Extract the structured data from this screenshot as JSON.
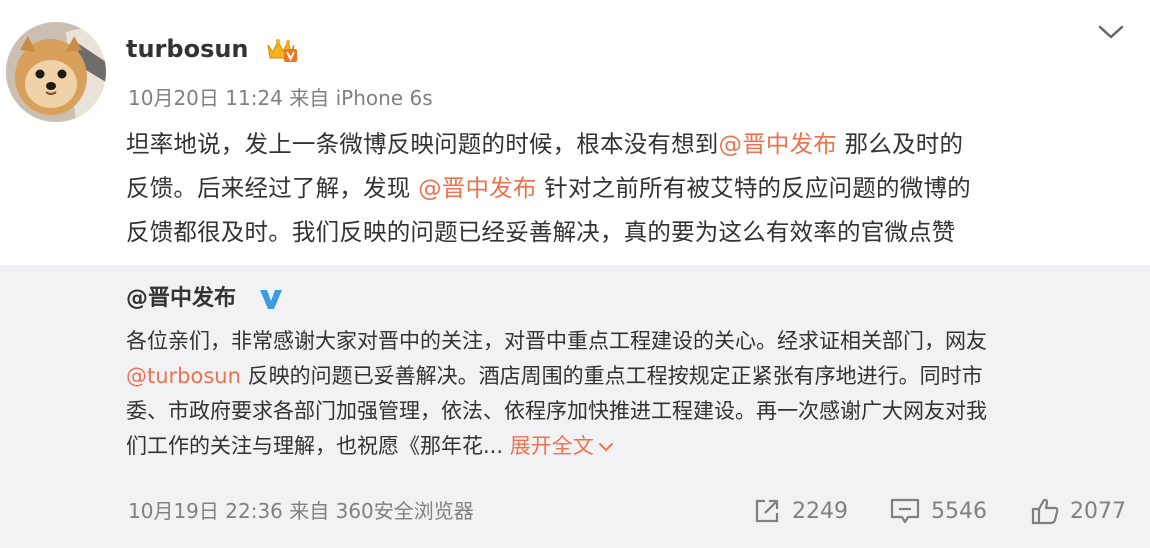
{
  "post": {
    "username": "turbosun",
    "vip_icon": "vip-crown-icon",
    "meta": "10月20日 11:24 来自 iPhone 6s",
    "text": {
      "line1_before": "坦率地说，发上一条微博反映问题的时候，根本没有想到",
      "mention1": "@晋中发布",
      "line1_after": " 那么及时的",
      "line2_before": "反馈。后来经过了解，发现 ",
      "mention2": "@晋中发布",
      "line2_after": " 针对之前所有被艾特的反应问题的微博的",
      "line3": "反馈都很及时。我们反映的问题已经妥善解决，真的要为这么有效率的官微点赞"
    }
  },
  "repost": {
    "author": "@晋中发布",
    "verified_icon": "verified-v-icon",
    "line1": "各位亲们，非常感谢大家对晋中的关注，对晋中重点工程建设的关心。经求证相关部门，网友",
    "mention": "@turbosun",
    "line2_after": " 反映的问题已妥善解决。酒店周围的重点工程按规定正紧张有序地进行。同时市",
    "line3": "委、市政府要求各部门加强管理，依法、依程序加快推进工程建设。再一次感谢广大网友对我",
    "line4": "们工作的关注与理解，也祝愿《那年花... ",
    "expand_label": "展开全文",
    "meta": "10月19日 22:36 来自 360安全浏览器"
  },
  "actions": {
    "repost_count": "2249",
    "comment_count": "5546",
    "like_count": "2077"
  },
  "colors": {
    "link": "#eb7350",
    "meta": "#808080",
    "repost_bg": "#f2f2f5",
    "verified": "#3a9fe0"
  }
}
